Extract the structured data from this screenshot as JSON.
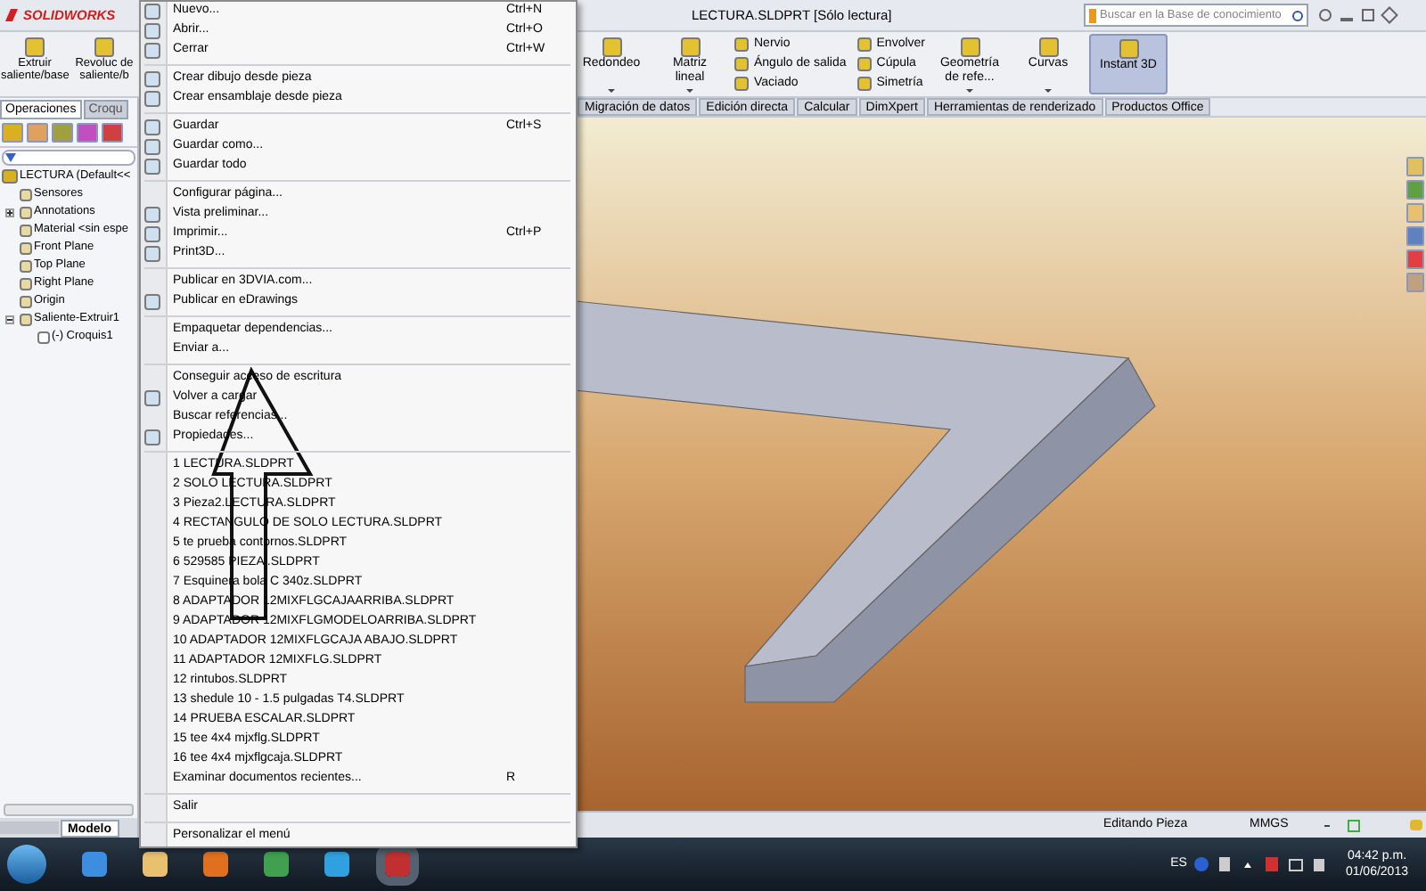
{
  "title_bar": {
    "logo": "SOLIDWORKS",
    "title": "LECTURA.SLDPRT [Sólo lectura]",
    "search": {
      "placeholder": "Buscar en la Base de conocimiento"
    }
  },
  "ribbon": {
    "left_buttons": [
      {
        "label": "Extruir saliente/base"
      },
      {
        "label": "Revoluc de saliente/b"
      }
    ],
    "right_items": [
      {
        "kind": "large",
        "label": "Redondeo",
        "dropdown": true,
        "selected": false
      },
      {
        "kind": "large",
        "label": "Matriz lineal",
        "dropdown": true,
        "selected": false
      },
      {
        "kind": "stack",
        "items": [
          "Nervio",
          "Ángulo de salida",
          "Vaciado"
        ]
      },
      {
        "kind": "stack",
        "items": [
          "Envolver",
          "Cúpula",
          "Simetría"
        ]
      },
      {
        "kind": "large",
        "label": "Geometría de refe...",
        "dropdown": true,
        "selected": false
      },
      {
        "kind": "large",
        "label": "Curvas",
        "dropdown": true,
        "selected": false
      },
      {
        "kind": "large",
        "label": "Instant 3D",
        "dropdown": false,
        "selected": true
      }
    ]
  },
  "left_tabs": [
    {
      "label": "Operaciones",
      "selected": true
    },
    {
      "label": "Croqu",
      "selected": false
    }
  ],
  "right_tabs": [
    "Migración de datos",
    "Edición directa",
    "Calcular",
    "DimXpert",
    "Herramientas de renderizado",
    "Productos Office"
  ],
  "feature_tree": {
    "root": "LECTURA  (Default<<",
    "items": [
      {
        "label": "Sensores"
      },
      {
        "label": "Annotations",
        "expanded": false
      },
      {
        "label": "Material <sin espe"
      },
      {
        "label": "Front Plane"
      },
      {
        "label": "Top Plane"
      },
      {
        "label": "Right Plane"
      },
      {
        "label": "Origin"
      },
      {
        "label": "Saliente-Extruir1",
        "expanded": true,
        "children": [
          {
            "label": "(-) Croquis1"
          }
        ]
      }
    ]
  },
  "bottom_tabs": [
    {
      "label": "Modelo",
      "selected": true
    }
  ],
  "file_menu": {
    "sections": [
      [
        {
          "label": "Nuevo...",
          "shortcut": "Ctrl+N",
          "has_icon": true
        },
        {
          "label": "Abrir...",
          "shortcut": "Ctrl+O",
          "has_icon": true
        },
        {
          "label": "Cerrar",
          "shortcut": "Ctrl+W",
          "has_icon": true
        }
      ],
      [
        {
          "label": "Crear dibujo desde pieza",
          "has_icon": true
        },
        {
          "label": "Crear ensamblaje desde pieza",
          "has_icon": true
        }
      ],
      [
        {
          "label": "Guardar",
          "shortcut": "Ctrl+S",
          "has_icon": true
        },
        {
          "label": "Guardar como...",
          "has_icon": true
        },
        {
          "label": "Guardar todo",
          "has_icon": true
        }
      ],
      [
        {
          "label": "Configurar página...",
          "has_icon": false
        },
        {
          "label": "Vista preliminar...",
          "has_icon": true
        },
        {
          "label": "Imprimir...",
          "shortcut": "Ctrl+P",
          "has_icon": true
        },
        {
          "label": "Print3D...",
          "has_icon": true
        }
      ],
      [
        {
          "label": "Publicar en 3DVIA.com...",
          "has_icon": false
        },
        {
          "label": "Publicar en eDrawings",
          "has_icon": true
        }
      ],
      [
        {
          "label": "Empaquetar dependencias...",
          "has_icon": false
        },
        {
          "label": "Enviar a...",
          "has_icon": false
        }
      ],
      [
        {
          "label": "Conseguir acceso de escritura",
          "has_icon": false
        },
        {
          "label": "Volver a cargar",
          "has_icon": true
        },
        {
          "label": "Buscar referencias...",
          "has_icon": false
        },
        {
          "label": "Propiedades...",
          "has_icon": true
        }
      ],
      [
        {
          "label": "1 LECTURA.SLDPRT",
          "has_icon": false
        },
        {
          "label": "2 SOLO LECTURA.SLDPRT",
          "has_icon": false
        },
        {
          "label": "3 Pieza2.LECTURA.SLDPRT",
          "has_icon": false
        },
        {
          "label": "4 RECTANGULO DE SOLO LECTURA.SLDPRT",
          "has_icon": false
        },
        {
          "label": "5 te prueba contornos.SLDPRT",
          "has_icon": false
        },
        {
          "label": "6 529585 PIEZA .SLDPRT",
          "has_icon": false
        },
        {
          "label": "7 Esquinera bola C 340z.SLDPRT",
          "has_icon": false
        },
        {
          "label": "8 ADAPTADOR 12MIXFLGCAJAARRIBA.SLDPRT",
          "has_icon": false
        },
        {
          "label": "9 ADAPTADOR 12MIXFLGMODELOARRIBA.SLDPRT",
          "has_icon": false
        },
        {
          "label": "10 ADAPTADOR 12MIXFLGCAJA ABAJO.SLDPRT",
          "has_icon": false
        },
        {
          "label": "11 ADAPTADOR 12MIXFLG.SLDPRT",
          "has_icon": false
        },
        {
          "label": "12 rintubos.SLDPRT",
          "has_icon": false
        },
        {
          "label": "13 shedule 10 - 1.5 pulgadas T4.SLDPRT",
          "has_icon": false
        },
        {
          "label": "14 PRUEBA ESCALAR.SLDPRT",
          "has_icon": false
        },
        {
          "label": "15 tee 4x4 mjxflg.SLDPRT",
          "has_icon": false
        },
        {
          "label": "16 tee 4x4 mjxflgcaja.SLDPRT",
          "has_icon": false
        },
        {
          "label": "Examinar documentos recientes...",
          "shortcut": "R",
          "has_icon": false
        }
      ],
      [
        {
          "label": "Salir",
          "has_icon": false
        }
      ],
      [
        {
          "label": "Personalizar el menú",
          "has_icon": false
        }
      ]
    ]
  },
  "status_bar": [
    "Editando Pieza",
    "MMGS"
  ],
  "taskbar": {
    "language": "ES",
    "time": "04:42 p.m.",
    "date": "01/06/2013"
  }
}
